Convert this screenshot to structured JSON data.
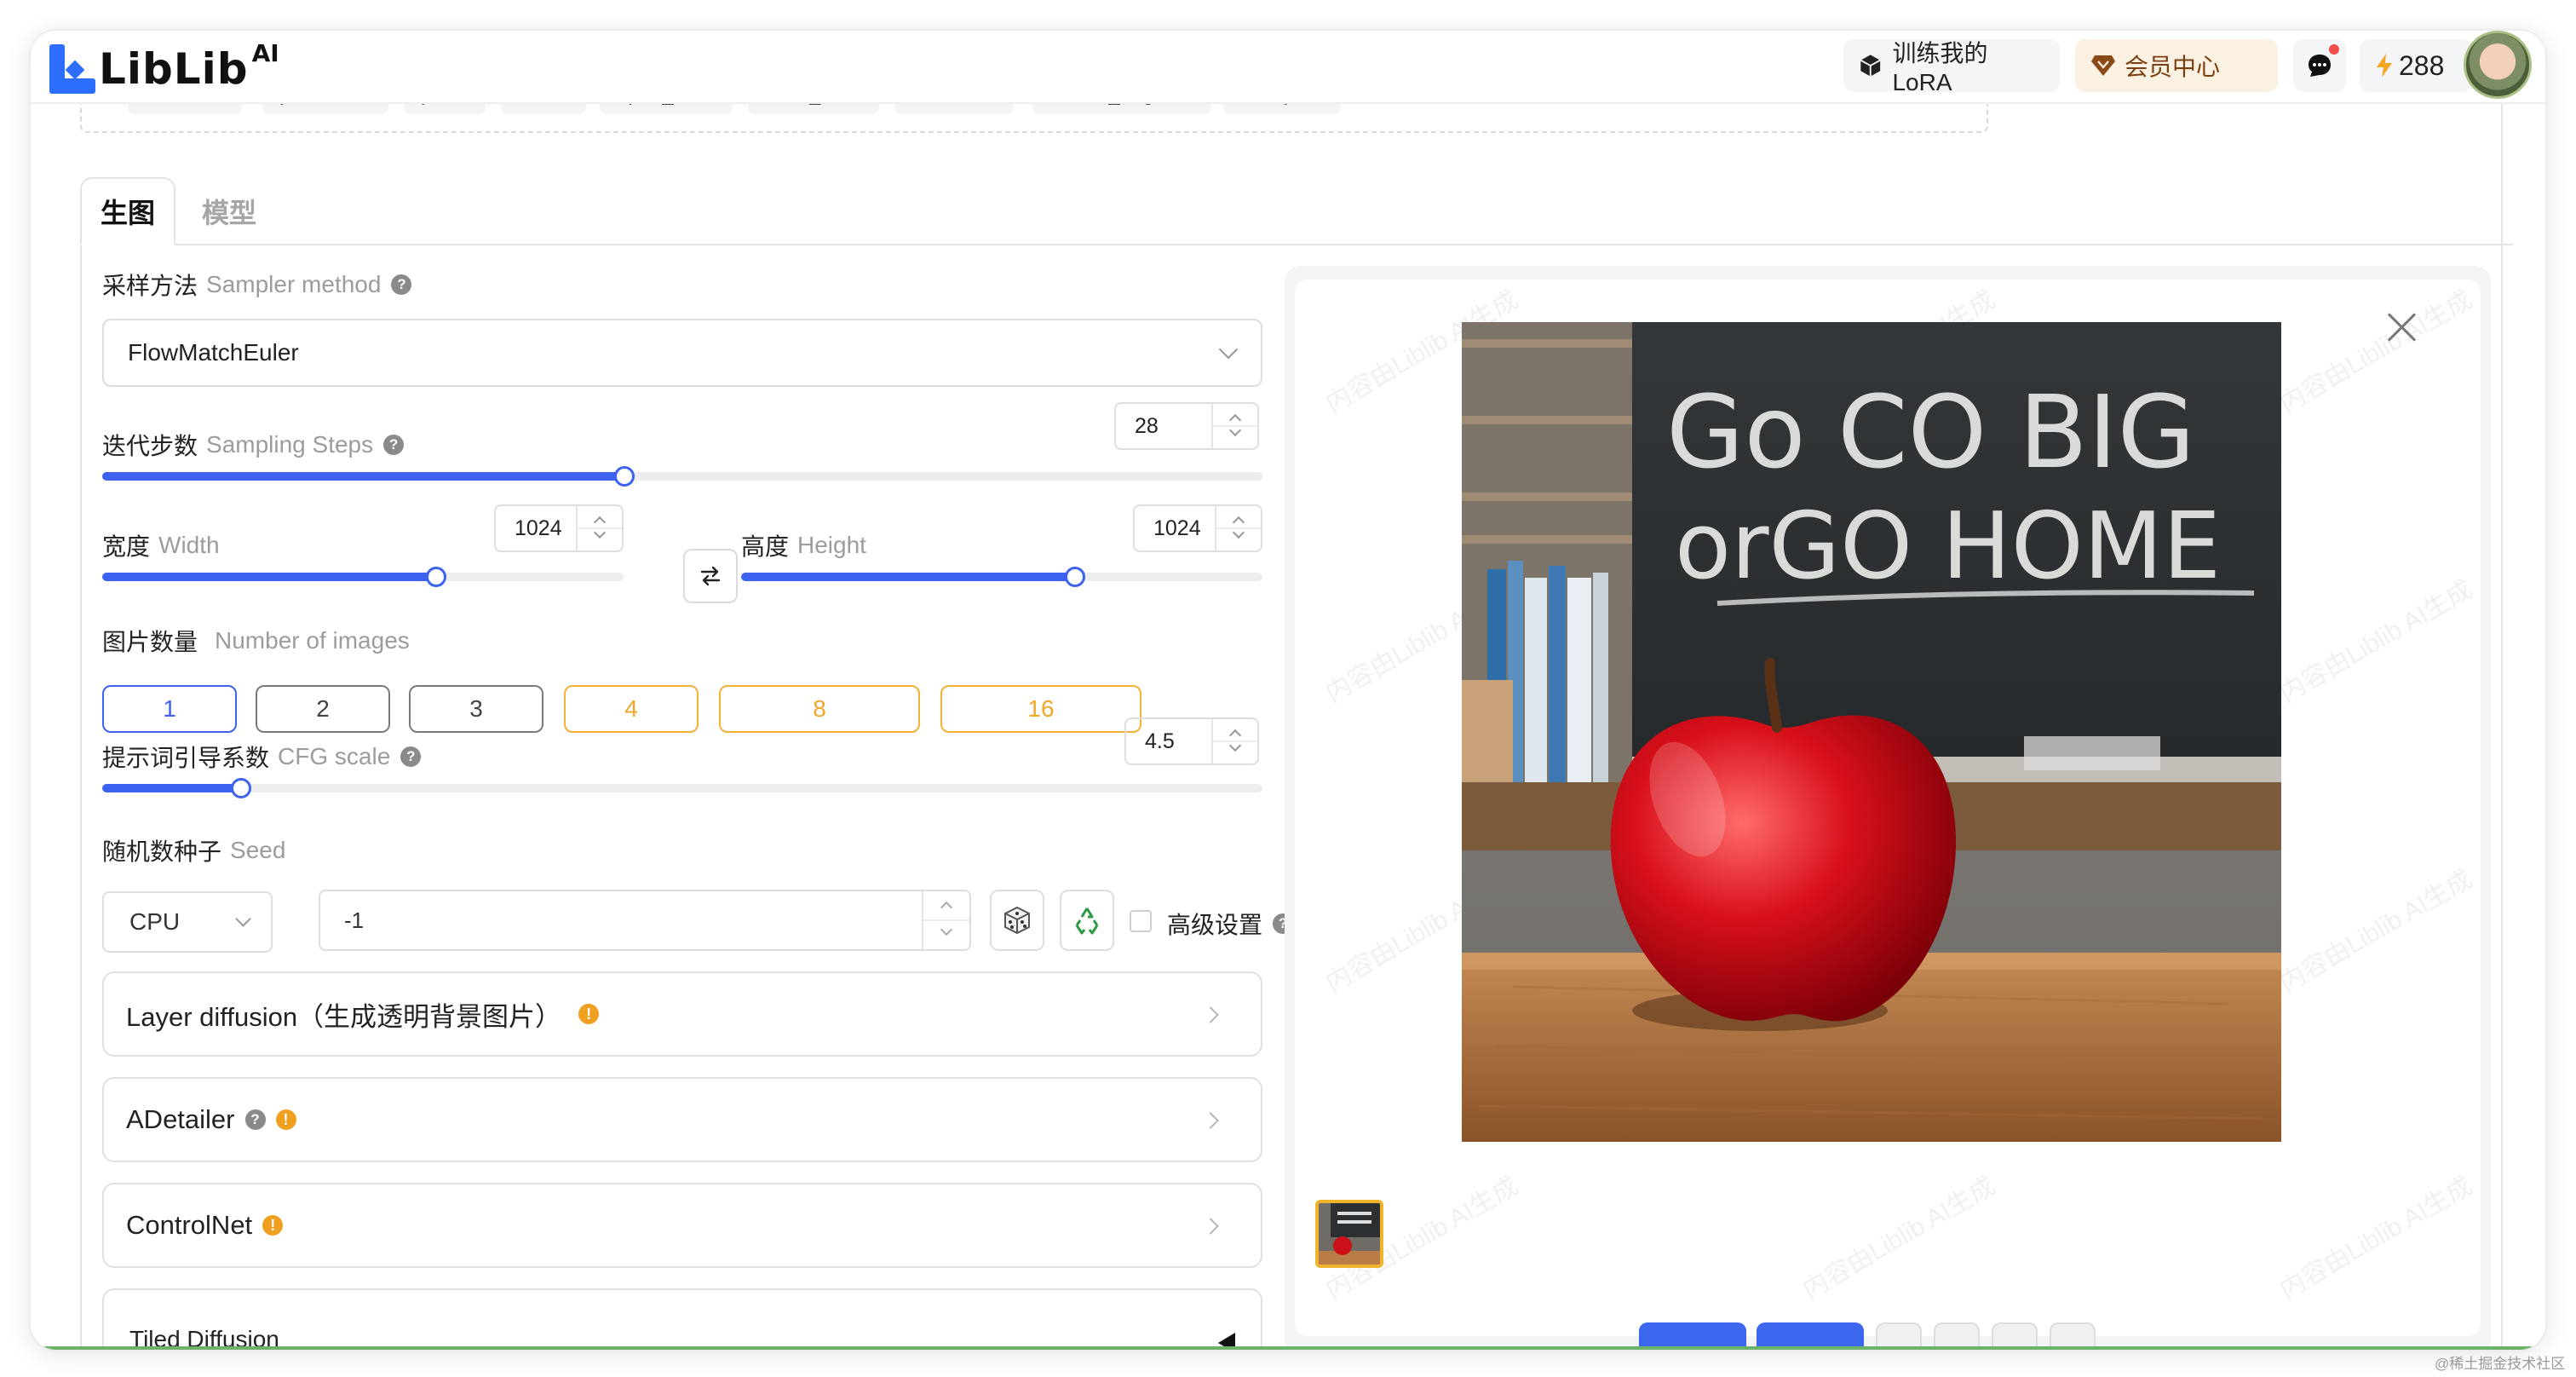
{
  "header": {
    "logo_text": "LibLib",
    "logo_sup": "AI",
    "train_lora": "训练我的LoRA",
    "vip_center": "会员中心",
    "credits": "288"
  },
  "tags": [
    "notebook",
    "paintbrush",
    "pencil",
    "book",
    "open_book",
    "book_stack",
    "bookshelf",
    "school_bag",
    "backpack"
  ],
  "tabs": {
    "generate": "生图",
    "model": "模型"
  },
  "sampler": {
    "label": "采样方法",
    "label_en": "Sampler method",
    "value": "FlowMatchEuler"
  },
  "steps": {
    "label": "迭代步数",
    "label_en": "Sampling Steps",
    "value": "28",
    "level": 0.45
  },
  "width": {
    "label": "宽度",
    "label_en": "Width",
    "value": "1024",
    "level": 0.64
  },
  "height": {
    "label": "高度",
    "label_en": "Height",
    "value": "1024",
    "level": 0.64
  },
  "num_images": {
    "label": "图片数量",
    "label_en": "Number of images",
    "options": [
      "1",
      "2",
      "3",
      "4",
      "8",
      "16"
    ],
    "selected": "1"
  },
  "cfg": {
    "label": "提示词引导系数",
    "label_en": "CFG scale",
    "value": "4.5",
    "level": 0.12
  },
  "seed": {
    "label": "随机数种子",
    "label_en": "Seed",
    "device": "CPU",
    "value": "-1",
    "advanced": "高级设置"
  },
  "accordions": [
    {
      "title": "Layer diffusion（生成透明背景图片）"
    },
    {
      "title": "ADetailer"
    },
    {
      "title": "ControlNet"
    }
  ],
  "tiled": {
    "title": "Tiled Diffusion"
  },
  "watermark": "内容由Liblib AI生成",
  "image_text": {
    "line1": "Go CO BIG",
    "line2": "orGO HOME"
  },
  "footer_note": "@稀土掘金技术社区",
  "colors": {
    "accent": "#3d62f0",
    "vip": "#f0a72a",
    "brand": "#2c6dfc"
  }
}
